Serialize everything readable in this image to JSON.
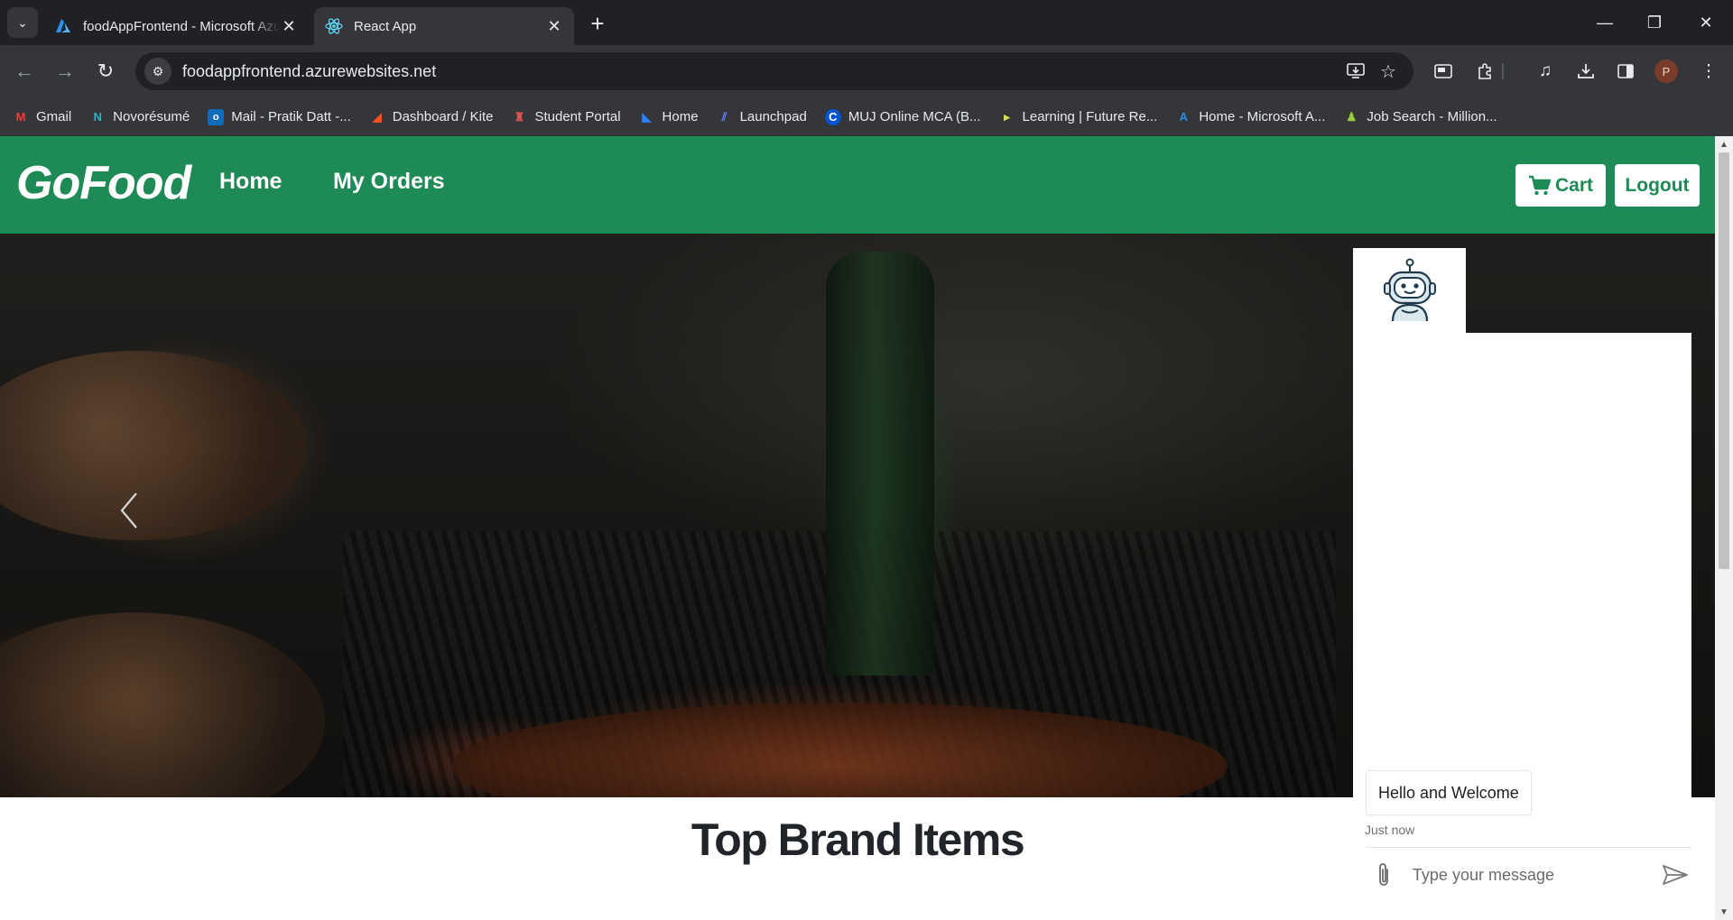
{
  "browser": {
    "tabs": [
      {
        "title": "foodAppFrontend - Microsoft Azure",
        "icon": "azure-icon",
        "active": false
      },
      {
        "title": "React App",
        "icon": "react-icon",
        "active": true
      }
    ],
    "url": "foodappfrontend.azurewebsites.net",
    "profile_initial": "P",
    "bookmarks": [
      {
        "label": "Gmail",
        "icon": "gmail-icon",
        "color": "#ea4335"
      },
      {
        "label": "Novorésumé",
        "icon": "novoresume-icon",
        "color": "#2eb3c9"
      },
      {
        "label": "Mail - Pratik Datt -...",
        "icon": "outlook-icon",
        "color": "#0f6cbd"
      },
      {
        "label": "Dashboard / Kite",
        "icon": "kite-icon",
        "color": "#f5511e"
      },
      {
        "label": "Student Portal",
        "icon": "portal-icon",
        "color": "#d9534f"
      },
      {
        "label": "Home",
        "icon": "home-bookmark-icon",
        "color": "#2a7fff"
      },
      {
        "label": "Launchpad",
        "icon": "launchpad-icon",
        "color": "#6a7dfe"
      },
      {
        "label": "MUJ Online MCA (B...",
        "icon": "coursera-icon",
        "color": "#0056d2"
      },
      {
        "label": "Learning | Future Re...",
        "icon": "learning-icon",
        "color": "#d4e157"
      },
      {
        "label": "Home - Microsoft A...",
        "icon": "azure-bookmark-icon",
        "color": "#2e8ae6"
      },
      {
        "label": "Job Search - Million...",
        "icon": "job-search-icon",
        "color": "#9ccc3c"
      }
    ]
  },
  "navbar": {
    "brand": "GoFood",
    "links": [
      "Home",
      "My Orders"
    ],
    "cart_label": "Cart",
    "logout_label": "Logout",
    "accent": "#1e8a55"
  },
  "hero": {
    "prev_label": "‹"
  },
  "section": {
    "title": "Top Brand Items"
  },
  "chat": {
    "message": "Hello and Welcome",
    "time": "Just now",
    "placeholder": "Type your message"
  }
}
